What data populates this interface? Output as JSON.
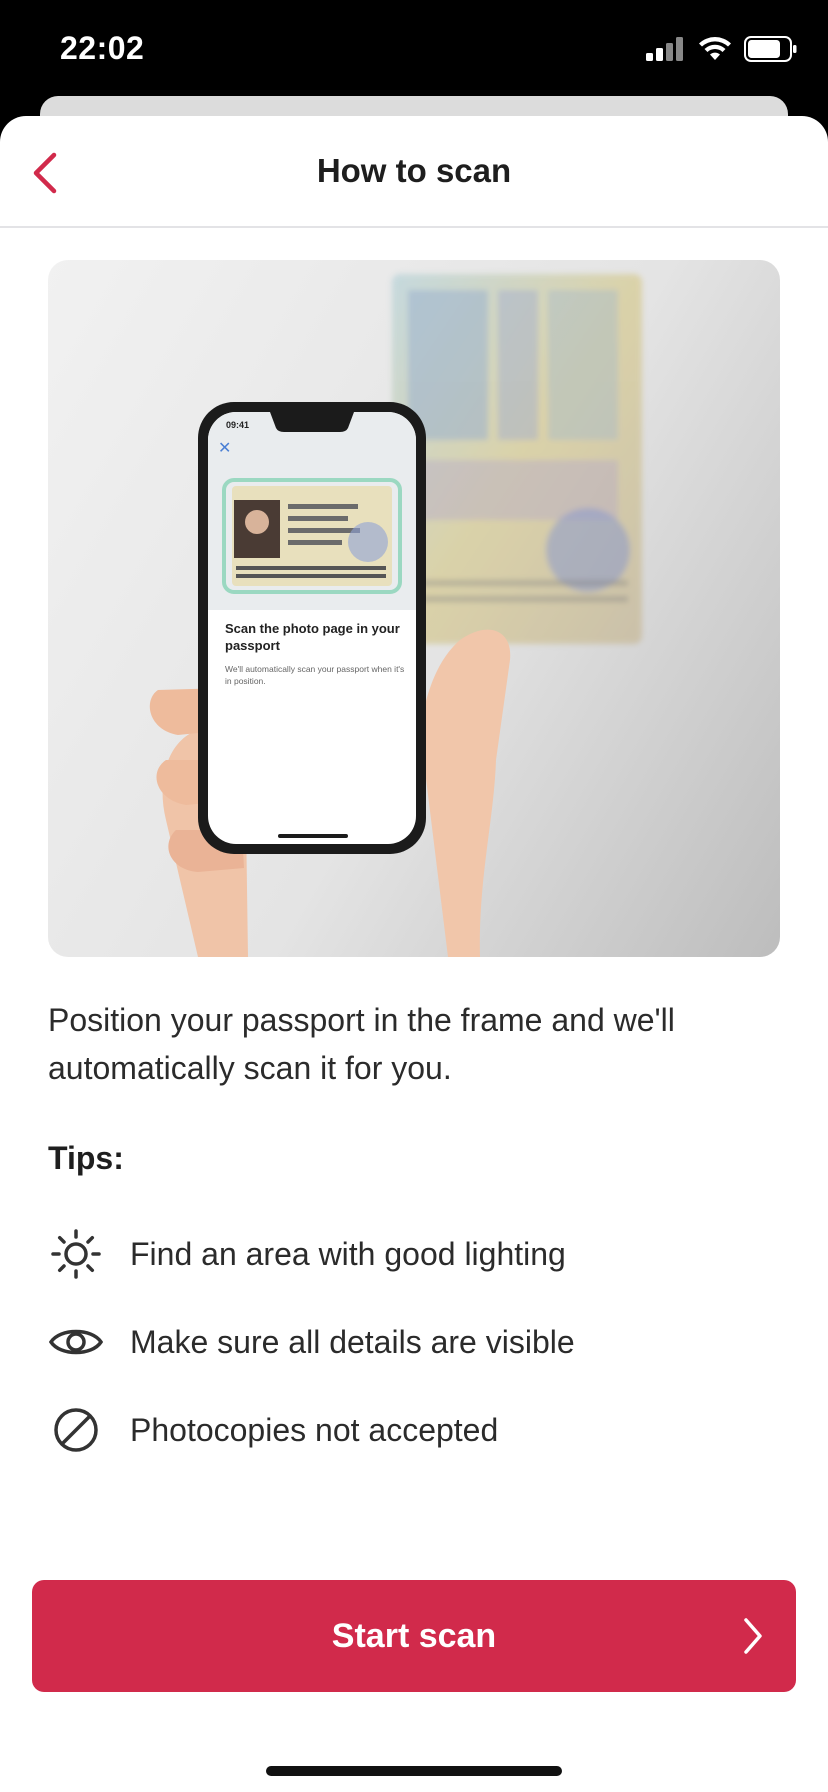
{
  "status_bar": {
    "time": "22:02",
    "icons": [
      "cellular-signal-icon",
      "wifi-icon",
      "battery-icon"
    ]
  },
  "header": {
    "back_icon": "chevron-left-icon",
    "title": "How to scan"
  },
  "illustration": {
    "phone_time": "09:41",
    "phone_close_icon": "close-icon",
    "phone_heading": "Scan the photo page in your passport",
    "phone_subtext": "We'll automatically scan your passport when it's in position."
  },
  "intro_text": "Position your passport in the frame and we'll automatically scan it for you.",
  "tips": {
    "heading": "Tips:",
    "items": [
      {
        "icon": "sun-icon",
        "text": "Find an area with good lighting"
      },
      {
        "icon": "eye-icon",
        "text": "Make sure all details are visible"
      },
      {
        "icon": "prohibited-icon",
        "text": "Photocopies not accepted"
      }
    ]
  },
  "cta": {
    "label": "Start scan",
    "icon": "chevron-right-icon"
  },
  "colors": {
    "accent": "#D12A4B",
    "text": "#2B2B2B",
    "status_bar": "#000000"
  }
}
